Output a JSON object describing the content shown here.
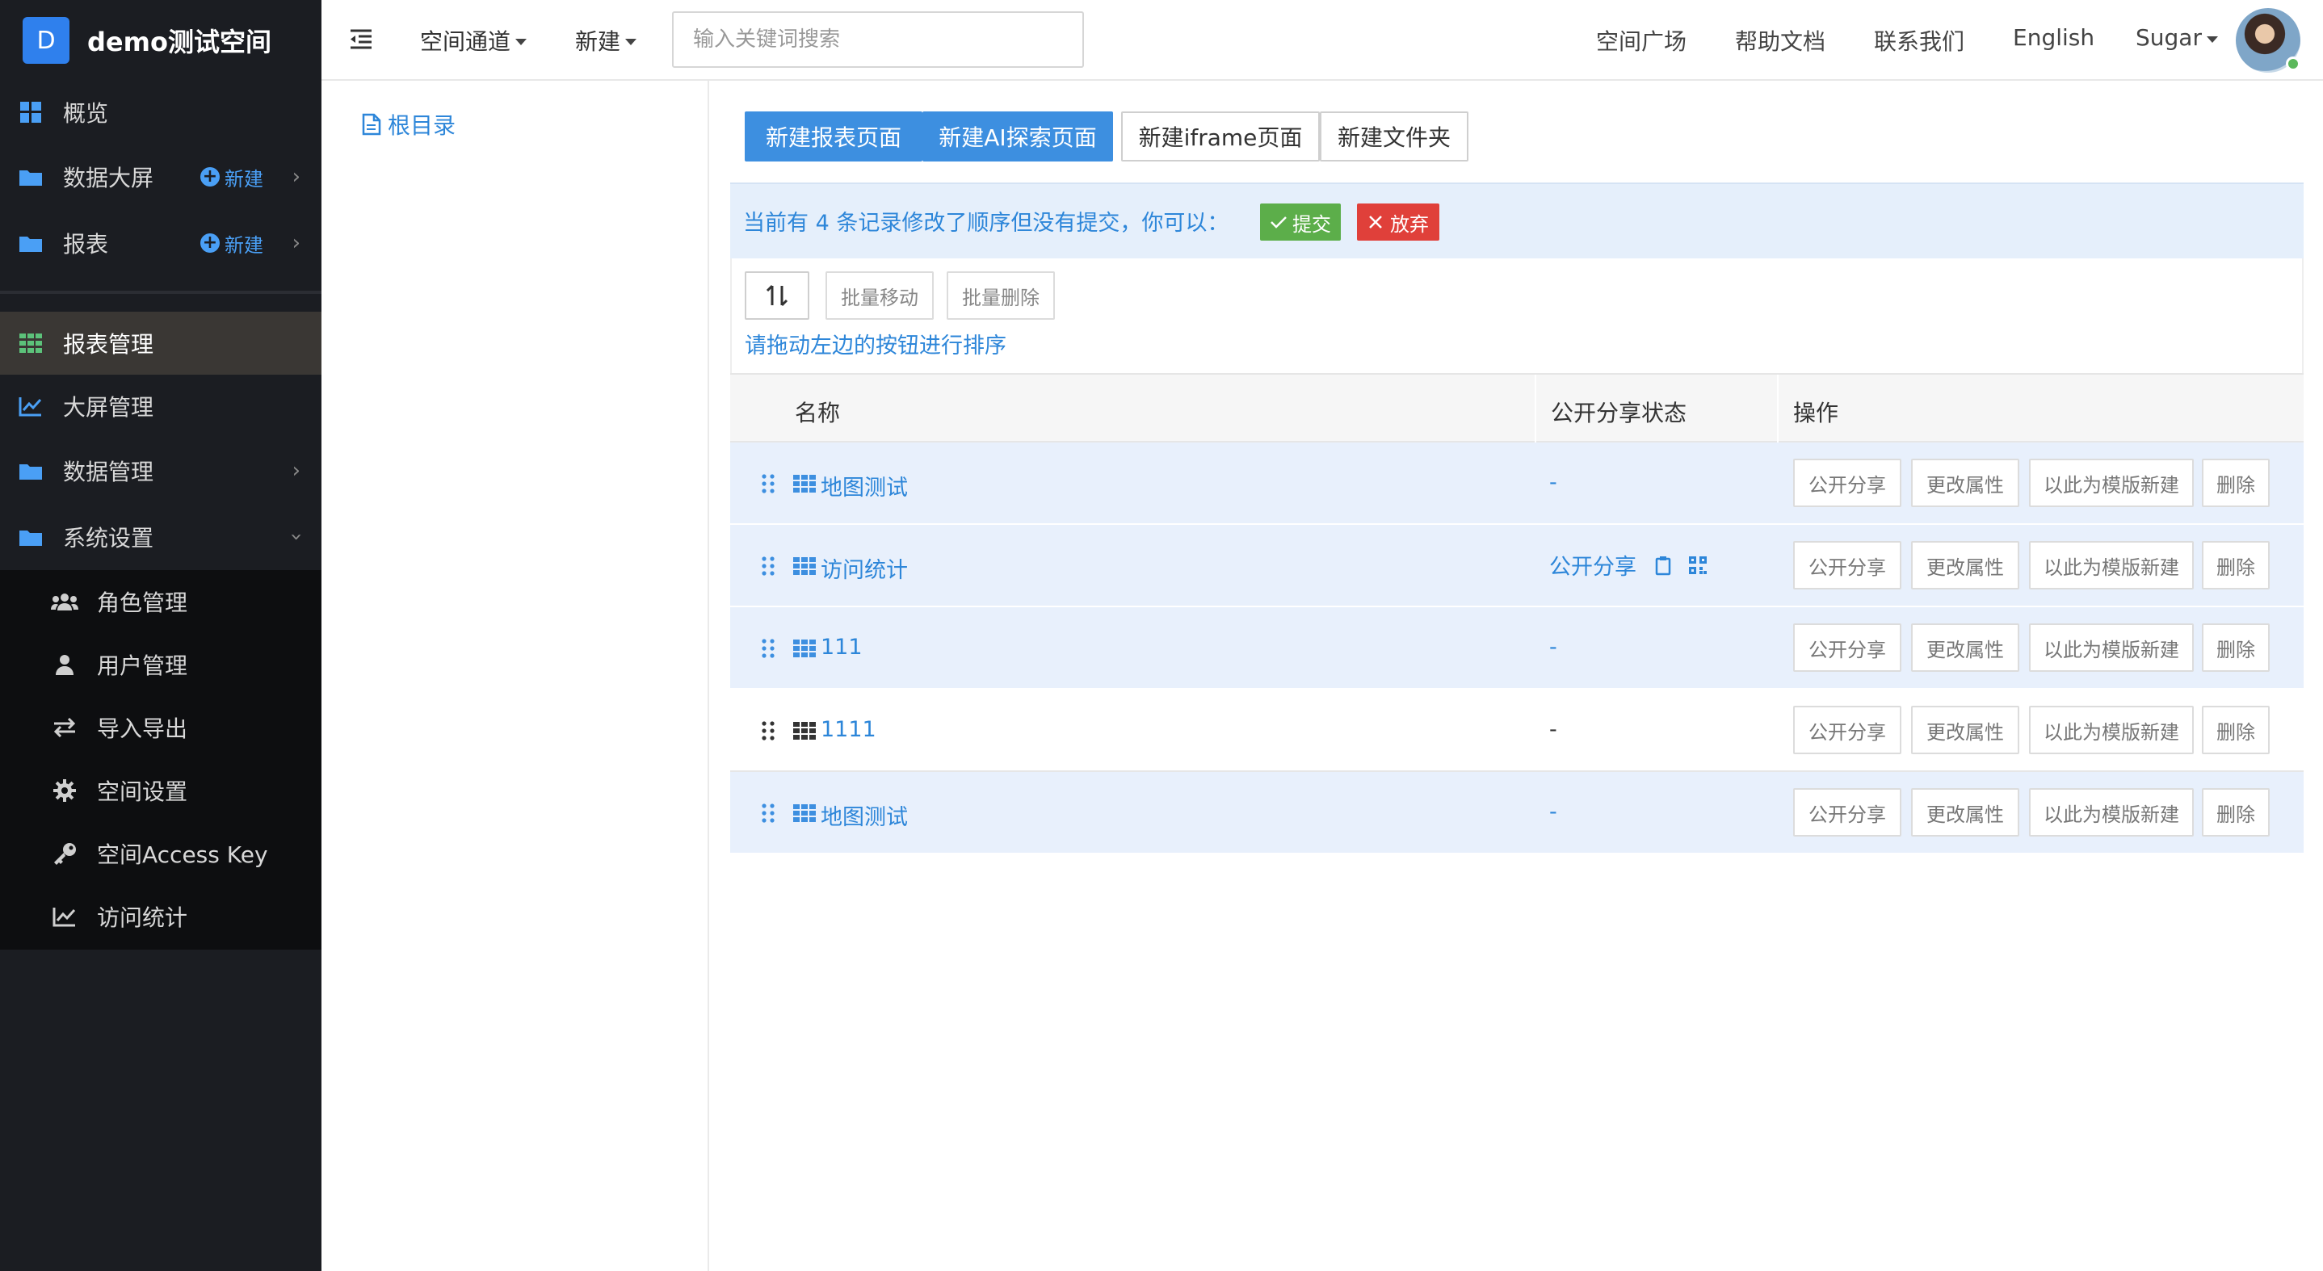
{
  "brand": {
    "logo_letter": "D",
    "name": "demo测试空间"
  },
  "sidebar": {
    "items": [
      {
        "label": "概览",
        "icon": "dashboard-icon"
      },
      {
        "label": "数据大屏",
        "icon": "folder-icon",
        "new_label": "新建"
      },
      {
        "label": "报表",
        "icon": "folder-icon",
        "new_label": "新建"
      },
      {
        "label": "报表管理",
        "icon": "grid-icon",
        "active": true
      },
      {
        "label": "大屏管理",
        "icon": "line-chart-icon"
      },
      {
        "label": "数据管理",
        "icon": "folder-icon"
      },
      {
        "label": "系统设置",
        "icon": "folder-icon"
      }
    ],
    "sub_items": [
      {
        "label": "角色管理",
        "icon": "users-icon"
      },
      {
        "label": "用户管理",
        "icon": "user-icon"
      },
      {
        "label": "导入导出",
        "icon": "exchange-icon"
      },
      {
        "label": "空间设置",
        "icon": "gear-icon"
      },
      {
        "label": "空间Access Key",
        "icon": "key-icon"
      },
      {
        "label": "访问统计",
        "icon": "line-chart-icon"
      }
    ]
  },
  "topbar": {
    "space_channel": "空间通道",
    "new": "新建",
    "search_placeholder": "输入关键词搜索",
    "links": [
      "空间广场",
      "帮助文档",
      "联系我们",
      "English"
    ],
    "user": "Sugar"
  },
  "tree": {
    "root_label": "根目录"
  },
  "actions": {
    "new_report": "新建报表页面",
    "new_ai": "新建AI探索页面",
    "new_iframe": "新建iframe页面",
    "new_folder": "新建文件夹"
  },
  "notice": {
    "text": "当前有 4 条记录修改了顺序但没有提交，你可以：",
    "submit": "提交",
    "discard": "放弃"
  },
  "toolbar": {
    "batch_move": "批量移动",
    "batch_delete": "批量删除",
    "hint": "请拖动左边的按钮进行排序"
  },
  "table": {
    "columns": [
      "名称",
      "公开分享状态",
      "操作"
    ],
    "row_actions": [
      "公开分享",
      "更改属性",
      "以此为模版新建",
      "删除"
    ],
    "rows": [
      {
        "name": "地图测试",
        "share": "-",
        "highlight": true
      },
      {
        "name": "访问统计",
        "share": "公开分享",
        "highlight": true
      },
      {
        "name": "111",
        "share": "-",
        "highlight": true
      },
      {
        "name": "1111",
        "share": "-",
        "highlight": false
      },
      {
        "name": "地图测试",
        "share": "-",
        "highlight": true
      }
    ]
  },
  "colors": {
    "sidebar_bg": "#1b1d22",
    "primary": "#3d8fe0",
    "link": "#2d86d9",
    "success": "#5cae4a",
    "danger": "#e0403a",
    "highlight_row": "#e8f0fc"
  }
}
